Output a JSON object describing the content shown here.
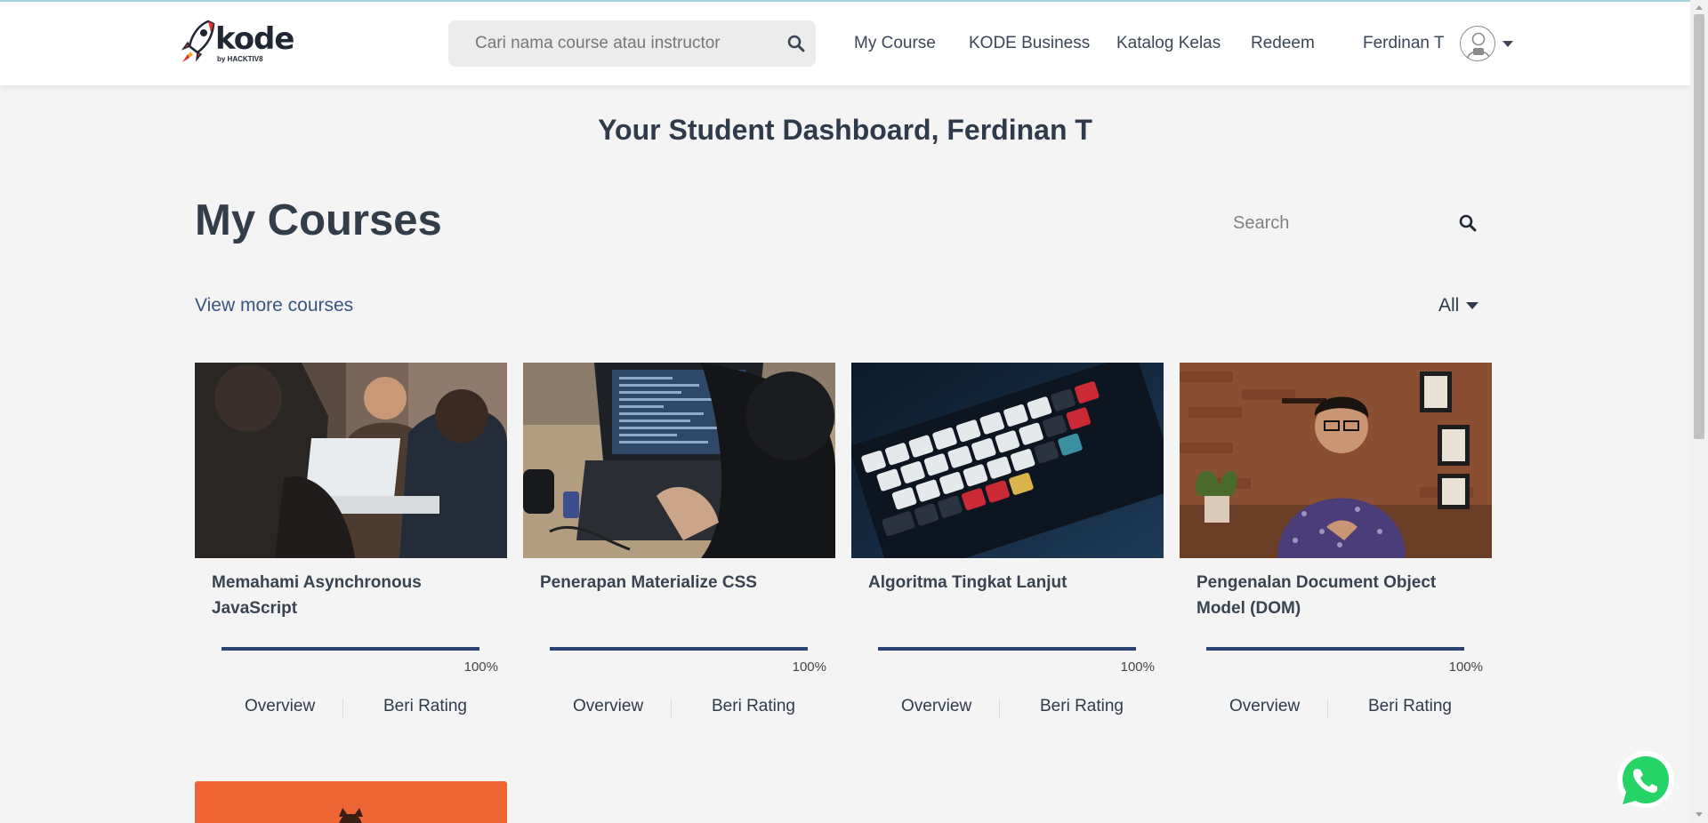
{
  "brand": {
    "logo_text": "kode",
    "logo_sub": "by HACKTIV8"
  },
  "header": {
    "search_placeholder": "Cari nama course atau instructor",
    "nav": [
      "My Course",
      "KODE Business",
      "Katalog Kelas",
      "Redeem"
    ],
    "user_name": "Ferdinan T"
  },
  "main": {
    "heading": "Your Student Dashboard, Ferdinan T",
    "section_title": "My Courses",
    "search_placeholder": "Search",
    "view_more": "View more courses",
    "filter": "All"
  },
  "courses": [
    {
      "title": "Memahami Asynchronous JavaScript",
      "progress_pct": 100,
      "progress_label": "100%",
      "overview": "Overview",
      "rating": "Beri Rating"
    },
    {
      "title": "Penerapan Materialize CSS",
      "progress_pct": 100,
      "progress_label": "100%",
      "overview": "Overview",
      "rating": "Beri Rating"
    },
    {
      "title": "Algoritma Tingkat Lanjut",
      "progress_pct": 100,
      "progress_label": "100%",
      "overview": "Overview",
      "rating": "Beri Rating"
    },
    {
      "title": "Pengenalan Document Object Model (DOM)",
      "progress_pct": 100,
      "progress_label": "100%",
      "overview": "Overview",
      "rating": "Beri Rating"
    }
  ],
  "icons": {
    "search": "search-icon",
    "avatar": "user-avatar-icon",
    "dropdown": "caret-down-icon",
    "chat": "whatsapp-icon"
  },
  "colors": {
    "accent": "#2a4375",
    "link": "#3a5480",
    "fifth_card": "#ef6435",
    "whatsapp": "#25d366"
  }
}
